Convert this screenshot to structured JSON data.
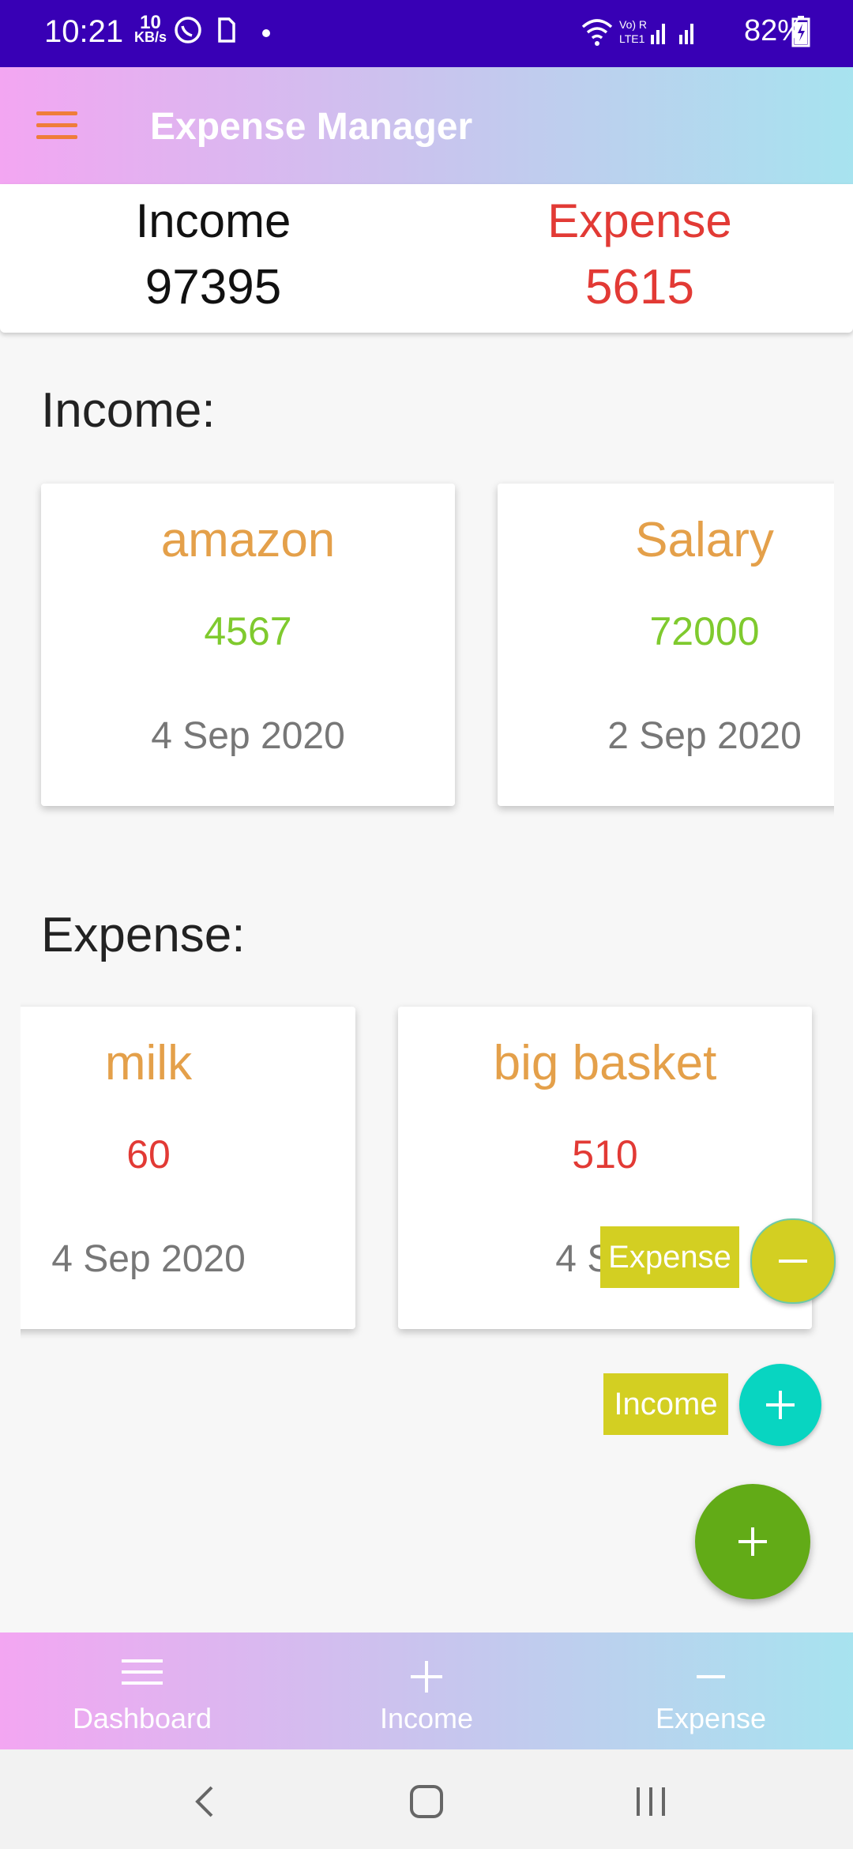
{
  "status_bar": {
    "time": "10:21",
    "speed_value": "10",
    "speed_unit": "KB/s",
    "battery": "82%"
  },
  "app_bar": {
    "title": "Expense Manager"
  },
  "summary": {
    "income_label": "Income",
    "income_value": "97395",
    "expense_label": "Expense",
    "expense_value": "5615"
  },
  "income_section": {
    "label": "Income:",
    "cards": [
      {
        "title": "amazon",
        "amount": "4567",
        "date": "4 Sep 2020"
      },
      {
        "title": "Salary",
        "amount": "72000",
        "date": "2 Sep 2020"
      }
    ]
  },
  "expense_section": {
    "label": "Expense:",
    "cards": [
      {
        "title": "milk",
        "amount": "60",
        "date": "4 Sep 2020"
      },
      {
        "title": "big basket",
        "amount": "510",
        "date": "4 Sep"
      }
    ]
  },
  "fab_menu": {
    "expense_label": "Expense",
    "income_label": "Income"
  },
  "bottom_nav": {
    "items": [
      {
        "label": "Dashboard",
        "icon": "menu-icon"
      },
      {
        "label": "Income",
        "icon": "plus-icon"
      },
      {
        "label": "Expense",
        "icon": "minus-icon"
      }
    ]
  },
  "colors": {
    "status_bar": "#3800b5",
    "card_title": "#e4a04a",
    "income_amount": "#7fca2e",
    "expense_amount": "#e23a35",
    "fab_main": "#62ab17",
    "fab_expense": "#d3cf22",
    "fab_income": "#08d5c1"
  }
}
